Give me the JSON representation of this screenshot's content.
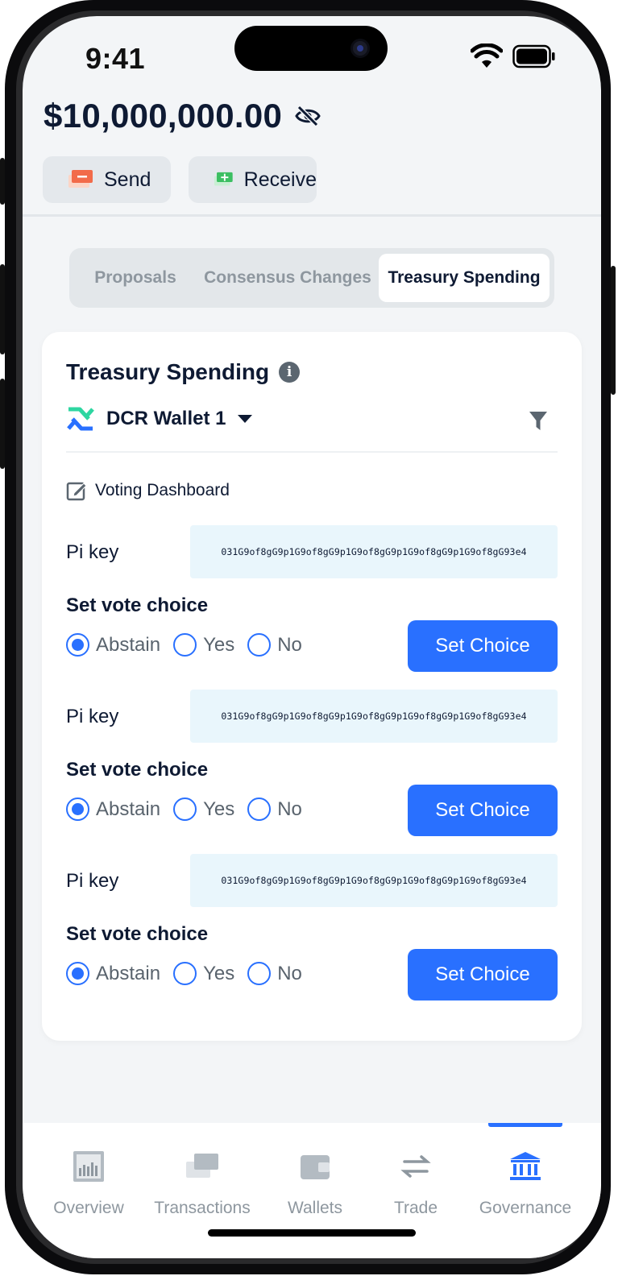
{
  "status_bar": {
    "time": "9:41"
  },
  "balance": {
    "amount": "$10,000,000.00"
  },
  "actions": {
    "send_label": "Send",
    "receive_label": "Receive"
  },
  "tabs": [
    {
      "label": "Proposals",
      "active": false
    },
    {
      "label": "Consensus Changes",
      "active": false
    },
    {
      "label": "Treasury Spending",
      "active": true
    }
  ],
  "card": {
    "title": "Treasury Spending",
    "wallet_name": "DCR Wallet 1",
    "dashboard_link": "Voting Dashboard",
    "votes": [
      {
        "pi_label": "Pi key",
        "pi_key": "031G9of8gG9p1G9of8gG9p1G9of8gG9p1G9of8gG9p1G9of8gG93e4",
        "title": "Set vote choice",
        "options": [
          "Abstain",
          "Yes",
          "No"
        ],
        "selected": "Abstain",
        "button": "Set Choice"
      },
      {
        "pi_label": "Pi key",
        "pi_key": "031G9of8gG9p1G9of8gG9p1G9of8gG9p1G9of8gG9p1G9of8gG93e4",
        "title": "Set vote choice",
        "options": [
          "Abstain",
          "Yes",
          "No"
        ],
        "selected": "Abstain",
        "button": "Set Choice"
      },
      {
        "pi_label": "Pi key",
        "pi_key": "031G9of8gG9p1G9of8gG9p1G9of8gG9p1G9of8gG9p1G9of8gG93e4",
        "title": "Set vote choice",
        "options": [
          "Abstain",
          "Yes",
          "No"
        ],
        "selected": "Abstain",
        "button": "Set Choice"
      }
    ]
  },
  "nav": [
    {
      "label": "Overview",
      "icon": "chart-icon"
    },
    {
      "label": "Transactions",
      "icon": "cards-icon"
    },
    {
      "label": "Wallets",
      "icon": "wallet-icon"
    },
    {
      "label": "Trade",
      "icon": "swap-icon"
    },
    {
      "label": "Governance",
      "icon": "bank-icon",
      "active": true
    }
  ],
  "colors": {
    "accent": "#2970ff",
    "navy": "#0e1a33",
    "pi_key_bg": "#e9f6fc",
    "background": "#f3f5f7"
  }
}
